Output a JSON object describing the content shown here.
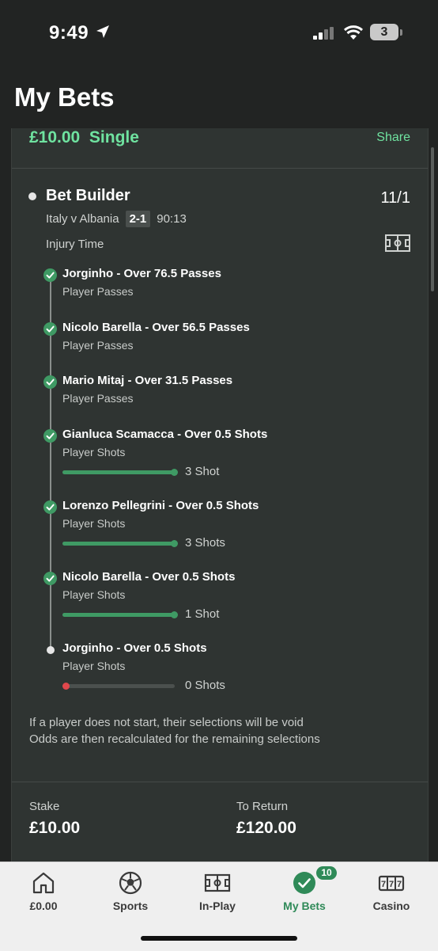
{
  "status_bar": {
    "time": "9:49",
    "battery": "3"
  },
  "page_title": "My Bets",
  "bet": {
    "stake_type": "£10.00  Single",
    "share_label": "Share",
    "builder_title": "Bet Builder",
    "odds": "11/1",
    "match": "Italy v Albania",
    "score": "2-1",
    "clock": "90:13",
    "period": "Injury Time",
    "selections": [
      {
        "name": "Jorginho - Over 76.5 Passes",
        "market": "Player Passes",
        "status": "won"
      },
      {
        "name": "Nicolo Barella - Over 56.5 Passes",
        "market": "Player Passes",
        "status": "won"
      },
      {
        "name": "Mario Mitaj - Over 31.5 Passes",
        "market": "Player Passes",
        "status": "won"
      },
      {
        "name": "Gianluca Scamacca - Over 0.5 Shots",
        "market": "Player Shots",
        "status": "won",
        "progress_label": "3 Shot",
        "progress": 1.0
      },
      {
        "name": "Lorenzo Pellegrini - Over 0.5 Shots",
        "market": "Player Shots",
        "status": "won",
        "progress_label": "3 Shots",
        "progress": 1.0
      },
      {
        "name": "Nicolo Barella - Over 0.5 Shots",
        "market": "Player Shots",
        "status": "won",
        "progress_label": "1 Shot",
        "progress": 1.0
      },
      {
        "name": "Jorginho - Over 0.5 Shots",
        "market": "Player Shots",
        "status": "pending",
        "progress_label": "0 Shots",
        "progress": 0.0
      }
    ],
    "void_note_line1": "If a player does not start, their selections will be void",
    "void_note_line2": "Odds are then recalculated for the remaining selections",
    "stake_label": "Stake",
    "stake_value": "£10.00",
    "return_label": "To Return",
    "return_value": "£120.00"
  },
  "tabbar": {
    "tabs": [
      {
        "label": "£0.00",
        "icon": "home-icon"
      },
      {
        "label": "Sports",
        "icon": "football-icon"
      },
      {
        "label": "In-Play",
        "icon": "pitch-icon"
      },
      {
        "label": "My Bets",
        "icon": "check-circle-icon",
        "active": true
      },
      {
        "label": "Casino",
        "icon": "slot-machine-icon"
      }
    ],
    "my_bets_badge": "10"
  },
  "colors": {
    "accent_green": "#6fe3a0",
    "success_green": "#3f9a64",
    "pending_red": "#e0474c",
    "card_bg": "#2f3432",
    "page_bg": "#222423"
  }
}
